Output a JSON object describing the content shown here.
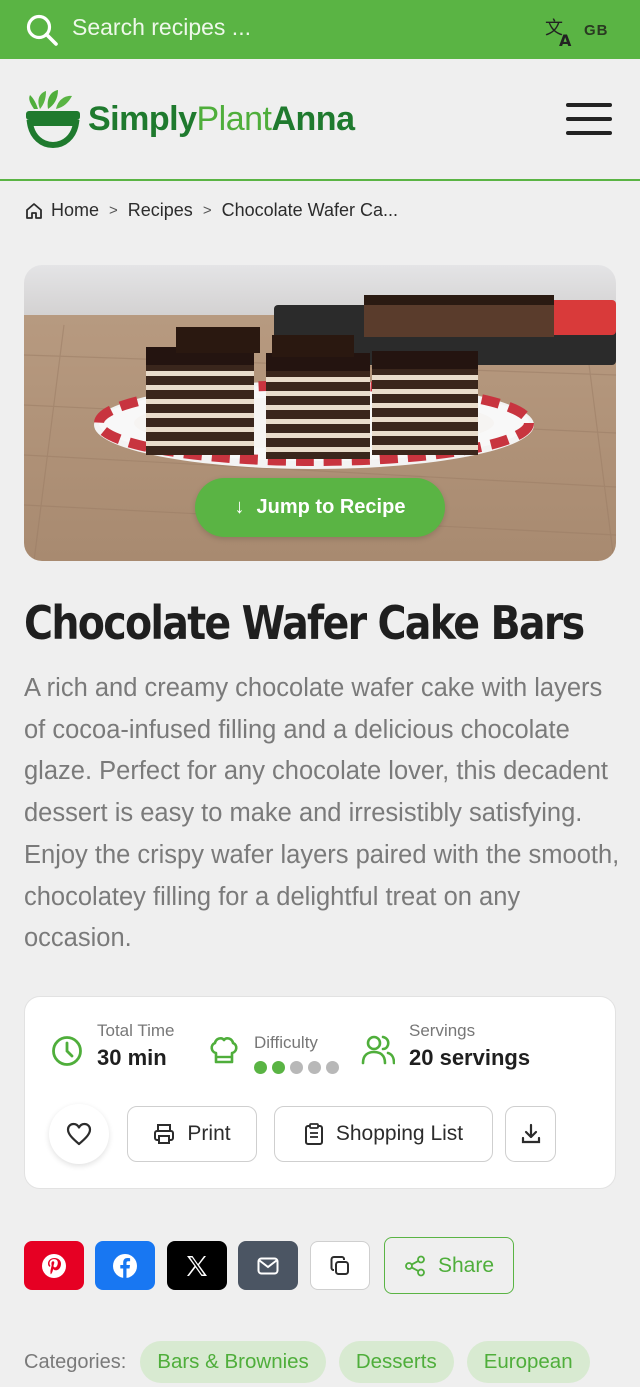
{
  "search": {
    "placeholder": "Search recipes ..."
  },
  "language": {
    "code": "GB"
  },
  "brand": {
    "part1": "Simply",
    "part2": "Plant",
    "part3": "Anna"
  },
  "breadcrumb": {
    "home": "Home",
    "recipes": "Recipes",
    "current": "Chocolate Wafer Ca...",
    "separator": ">"
  },
  "hero": {
    "jump_label": "Jump to Recipe"
  },
  "recipe": {
    "title": "Chocolate Wafer Cake Bars",
    "description": "A rich and creamy chocolate wafer cake with layers of cocoa-infused filling and a delicious chocolate glaze. Perfect for any chocolate lover, this decadent dessert is easy to make and irresistibly satisfying. Enjoy the crispy wafer layers paired with the smooth, chocolatey filling for a delightful treat on any occasion."
  },
  "meta": {
    "total_time_label": "Total Time",
    "total_time_value": "30 min",
    "difficulty_label": "Difficulty",
    "difficulty_level": 2,
    "difficulty_max": 5,
    "servings_label": "Servings",
    "servings_value": "20 servings"
  },
  "actions": {
    "print": "Print",
    "shopping_list": "Shopping List"
  },
  "share": {
    "label": "Share"
  },
  "categories": {
    "label": "Categories:",
    "items": [
      "Bars & Brownies",
      "Desserts",
      "European"
    ]
  },
  "colors": {
    "accent": "#5ab444",
    "dark_green": "#1f7a2e",
    "pinterest": "#e60023",
    "facebook": "#1877f2",
    "x": "#000000",
    "email": "#4b5563"
  }
}
